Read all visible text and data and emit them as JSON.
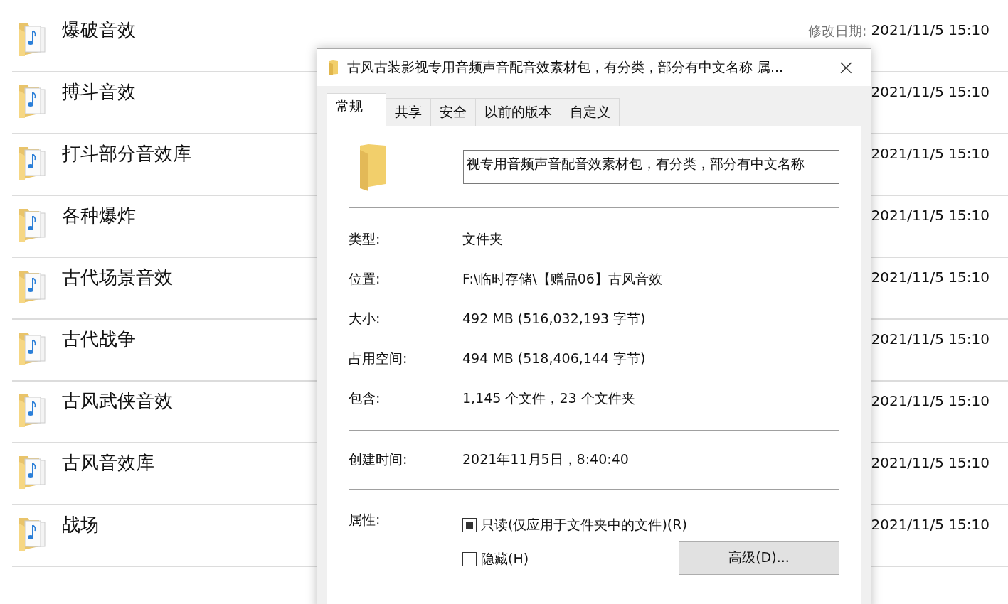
{
  "files": [
    {
      "name": "爆破音效",
      "date_label": "修改日期:",
      "date": "2021/11/5 15:10"
    },
    {
      "name": "搏斗音效",
      "date": "2021/11/5 15:10"
    },
    {
      "name": "打斗部分音效库",
      "date": "2021/11/5 15:10"
    },
    {
      "name": "各种爆炸",
      "date": "2021/11/5 15:10"
    },
    {
      "name": "古代场景音效",
      "date": "2021/11/5 15:10"
    },
    {
      "name": "古代战争",
      "date": "2021/11/5 15:10"
    },
    {
      "name": "古风武侠音效",
      "date": "2021/11/5 15:10"
    },
    {
      "name": "古风音效库",
      "date": "2021/11/5 15:10"
    },
    {
      "name": "战场",
      "date": "2021/11/5 15:10"
    }
  ],
  "dialog": {
    "title": "古风古装影视专用音频声音配音效素材包，有分类，部分有中文名称 属...",
    "close": "×",
    "tabs": [
      {
        "label": "常规",
        "selected": true
      },
      {
        "label": "共享",
        "selected": false
      },
      {
        "label": "安全",
        "selected": false
      },
      {
        "label": "以前的版本",
        "selected": false
      },
      {
        "label": "自定义",
        "selected": false
      }
    ],
    "name_field": {
      "value": "视专用音频声音配音效素材包，有分类，部分有中文名称"
    },
    "properties": [
      {
        "label": "类型:",
        "value": "文件夹"
      },
      {
        "label": "位置:",
        "value": "F:\\临时存储\\【赠品06】古风音效"
      },
      {
        "label": "大小:",
        "value": "492 MB (516,032,193 字节)"
      },
      {
        "label": "占用空间:",
        "value": "494 MB (518,406,144 字节)"
      },
      {
        "label": "包含:",
        "value": "1,145 个文件，23 个文件夹"
      }
    ],
    "created": {
      "label": "创建时间:",
      "value": "2021年11月5日，8:40:40"
    },
    "attributes": {
      "label": "属性:",
      "options": [
        {
          "label": "只读(仅应用于文件夹中的文件)(R)",
          "checked": false,
          "indeterminate": true
        },
        {
          "label": "隐藏(H)",
          "checked": false,
          "indeterminate": false
        }
      ]
    },
    "advanced_button": "高级(D)..."
  }
}
